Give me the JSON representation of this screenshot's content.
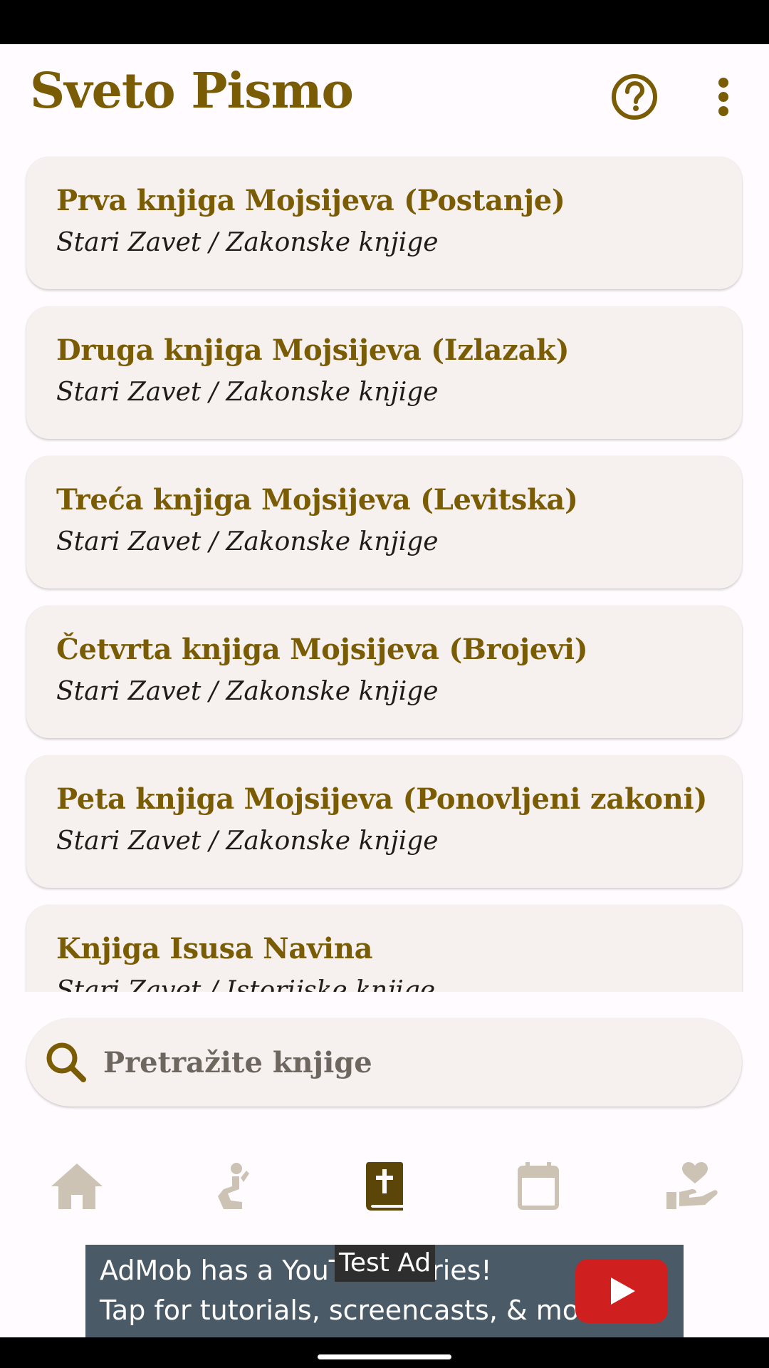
{
  "app": {
    "title": "Sveto Pismo"
  },
  "toolbar": {
    "help_icon": "help-circle-icon",
    "more_icon": "more-vert-icon"
  },
  "books": [
    {
      "title": "Prva knjiga Mojsijeva (Postanje)",
      "subtitle": "Stari Zavet / Zakonske knjige"
    },
    {
      "title": "Druga knjiga Mojsijeva (Izlazak)",
      "subtitle": "Stari Zavet / Zakonske knjige"
    },
    {
      "title": "Treća knjiga Mojsijeva (Levitska)",
      "subtitle": "Stari Zavet / Zakonske knjige"
    },
    {
      "title": "Četvrta knjiga Mojsijeva (Brojevi)",
      "subtitle": "Stari Zavet / Zakonske knjige"
    },
    {
      "title": "Peta knjiga Mojsijeva (Ponovljeni zakoni)",
      "subtitle": "Stari Zavet / Zakonske knjige"
    },
    {
      "title": "Knjiga Isusa Navina",
      "subtitle": "Stari Zavet / Istorijske knjige"
    }
  ],
  "search": {
    "placeholder": "Pretražite knjige",
    "value": ""
  },
  "bottom_nav": {
    "items": [
      {
        "icon": "home-icon",
        "active": false
      },
      {
        "icon": "praying-person-icon",
        "active": false
      },
      {
        "icon": "bible-book-icon",
        "active": true
      },
      {
        "icon": "calendar-icon",
        "active": false
      },
      {
        "icon": "hand-heart-icon",
        "active": false
      }
    ]
  },
  "ad": {
    "label": "Test Ad",
    "line1": "AdMob has a YouTube series!",
    "line2": "Tap for tutorials, screencasts, & more."
  },
  "colors": {
    "accent": "#7a5c05",
    "card_bg": "#f6f1ee",
    "nav_active": "#5c4508",
    "nav_inactive": "#ccc3b5",
    "background": "#fffbfe"
  }
}
